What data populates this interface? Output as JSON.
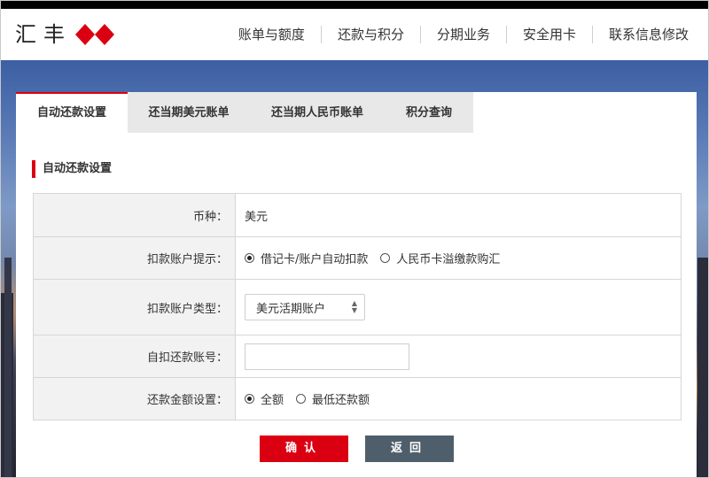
{
  "header": {
    "logo_text": "汇丰",
    "logo_icon": "hsbc-hexagon-icon",
    "nav": [
      "账单与额度",
      "还款与积分",
      "分期业务",
      "安全用卡",
      "联系信息修改"
    ]
  },
  "tabs": [
    {
      "label": "自动还款设置",
      "active": true
    },
    {
      "label": "还当期美元账单",
      "active": false
    },
    {
      "label": "还当期人民币账单",
      "active": false
    },
    {
      "label": "积分查询",
      "active": false
    }
  ],
  "section_title": "自动还款设置",
  "form": {
    "currency_label": "币种：",
    "currency_value": "美元",
    "debit_prompt_label": "扣款账户提示：",
    "debit_prompt_options": [
      "借记卡/账户自动扣款",
      "人民币卡溢缴款购汇"
    ],
    "debit_prompt_selected": 0,
    "account_type_label": "扣款账户类型：",
    "account_type_value": "美元活期账户",
    "account_number_label": "自扣还款账号：",
    "account_number_value": "",
    "amount_label": "还款金额设置：",
    "amount_options": [
      "全额",
      "最低还款额"
    ],
    "amount_selected": 0
  },
  "buttons": {
    "confirm": "确认",
    "back": "返回"
  },
  "colors": {
    "accent_red": "#db0011",
    "back_button": "#4e5e6b",
    "label_bg": "#f2f2f2",
    "tab_inactive_bg": "#e8e8e8"
  }
}
